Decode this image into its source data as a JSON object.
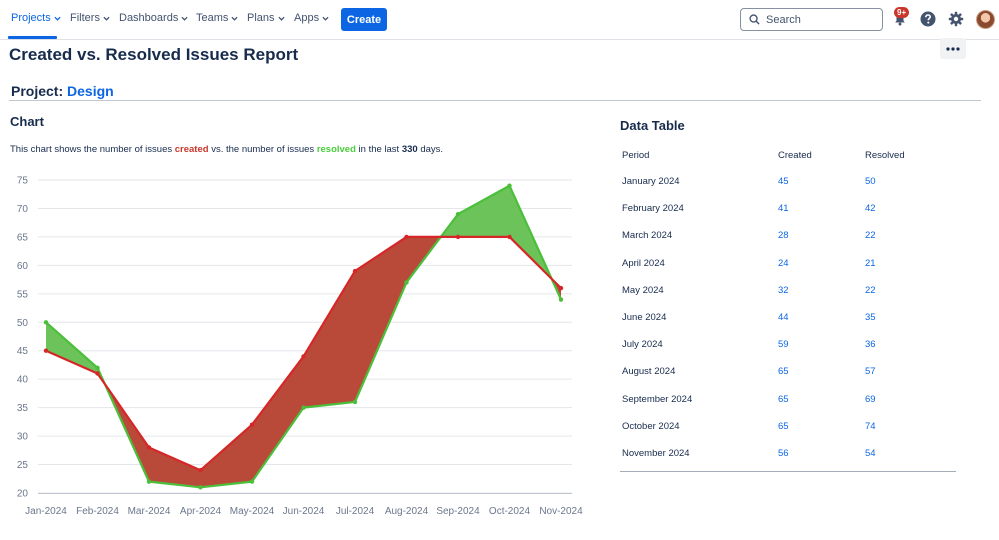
{
  "nav": {
    "items": [
      {
        "label": "Projects",
        "active": true
      },
      {
        "label": "Filters",
        "active": false
      },
      {
        "label": "Dashboards",
        "active": false
      },
      {
        "label": "Teams",
        "active": false
      },
      {
        "label": "Plans",
        "active": false
      },
      {
        "label": "Apps",
        "active": false
      }
    ],
    "create_label": "Create",
    "search_placeholder": "Search",
    "notification_badge": "9+"
  },
  "page": {
    "title": "Created vs. Resolved Issues Report",
    "project_label": "Project:",
    "project_name": "Design",
    "chart_heading": "Chart",
    "desc_part1": "This chart shows the number of issues ",
    "desc_created": "created",
    "desc_part2": " vs. the number of issues ",
    "desc_resolved": "resolved",
    "desc_part3": " in the last ",
    "desc_days": "330",
    "desc_part4": " days.",
    "table_heading": "Data Table"
  },
  "table": {
    "headers": [
      "Period",
      "Created",
      "Resolved"
    ],
    "rows": [
      {
        "period": "January 2024",
        "created": "45",
        "resolved": "50"
      },
      {
        "period": "February 2024",
        "created": "41",
        "resolved": "42"
      },
      {
        "period": "March 2024",
        "created": "28",
        "resolved": "22"
      },
      {
        "period": "April 2024",
        "created": "24",
        "resolved": "21"
      },
      {
        "period": "May 2024",
        "created": "32",
        "resolved": "22"
      },
      {
        "period": "June 2024",
        "created": "44",
        "resolved": "35"
      },
      {
        "period": "July 2024",
        "created": "59",
        "resolved": "36"
      },
      {
        "period": "August 2024",
        "created": "65",
        "resolved": "57"
      },
      {
        "period": "September 2024",
        "created": "65",
        "resolved": "69"
      },
      {
        "period": "October 2024",
        "created": "65",
        "resolved": "74"
      },
      {
        "period": "November 2024",
        "created": "56",
        "resolved": "54"
      }
    ]
  },
  "colors": {
    "accent": "#0c66e4",
    "created": "#d62728",
    "resolved": "#4bbf3a",
    "created_fill": "#b94a3a",
    "resolved_fill": "#6cc35a"
  },
  "chart_data": {
    "type": "area",
    "categories": [
      "Jan-2024",
      "Feb-2024",
      "Mar-2024",
      "Apr-2024",
      "May-2024",
      "Jun-2024",
      "Jul-2024",
      "Aug-2024",
      "Sep-2024",
      "Oct-2024",
      "Nov-2024"
    ],
    "series": [
      {
        "name": "created",
        "values": [
          45,
          41,
          28,
          24,
          32,
          44,
          59,
          65,
          65,
          65,
          56
        ]
      },
      {
        "name": "resolved",
        "values": [
          50,
          42,
          22,
          21,
          22,
          35,
          36,
          57,
          69,
          74,
          54
        ]
      }
    ],
    "yticks": [
      20,
      25,
      30,
      35,
      40,
      45,
      50,
      55,
      60,
      65,
      70,
      75
    ],
    "ylim": [
      19,
      77
    ],
    "grid": true
  }
}
